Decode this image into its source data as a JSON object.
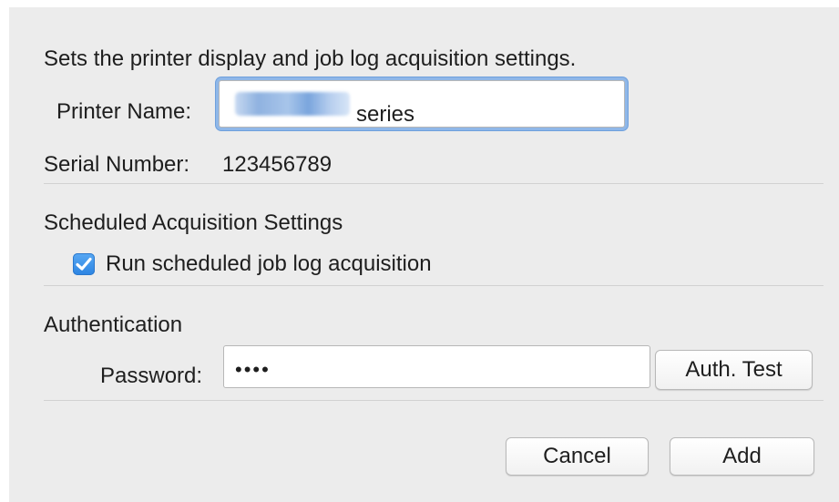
{
  "dialog": {
    "description": "Sets the printer display and job log acquisition settings."
  },
  "printer": {
    "label": "Printer Name:",
    "value": "series"
  },
  "serial": {
    "label": "Serial Number:",
    "value": "123456789"
  },
  "schedule": {
    "heading": "Scheduled Acquisition Settings",
    "checkbox_label": "Run scheduled job log acquisition",
    "checked": true
  },
  "authentication": {
    "heading": "Authentication",
    "password_label": "Password:",
    "password_mask": "••••",
    "test_button": "Auth. Test"
  },
  "actions": {
    "cancel": "Cancel",
    "add": "Add"
  },
  "colors": {
    "dialog_background": "#ececec",
    "focus_ring": "#6ea0dd",
    "checkbox_fill": "#2c84e2"
  }
}
